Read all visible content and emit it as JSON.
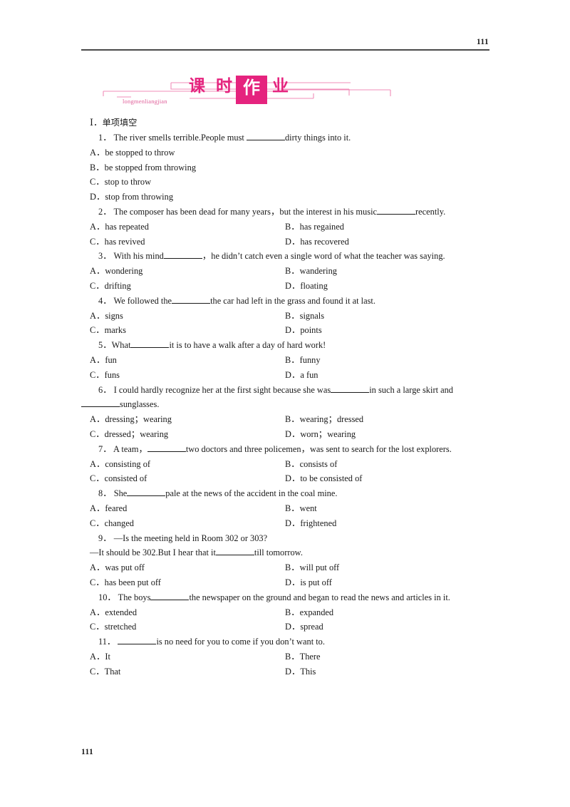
{
  "header": {
    "folio": "111"
  },
  "banner": {
    "pinyin": "longmenliangjian",
    "char1": "课",
    "char2": "时",
    "char3_boxed": "作",
    "char4": "业",
    "accent_color": "#e5237e",
    "accent_light": "#f2a0c4"
  },
  "section": {
    "label": "Ⅰ",
    "separator": "．",
    "title_cn": "单项填空"
  },
  "questions": [
    {
      "number": "1．",
      "stem_pre": "The river smells terrible.People must ",
      "stem_post": "dirty things into it.",
      "layout": "stacked",
      "options": [
        {
          "mark": "A．",
          "text": "be stopped to throw"
        },
        {
          "mark": "B．",
          "text": "be stopped from throwing"
        },
        {
          "mark": "C．",
          "text": "stop to throw"
        },
        {
          "mark": "D．",
          "text": "stop from throwing"
        }
      ]
    },
    {
      "number": "2．",
      "stem_pre": "The composer has been dead for many years，but the interest in his music",
      "stem_post": "recently.",
      "justify": true,
      "layout": "two-column",
      "options": [
        {
          "mark": "A．",
          "text": "has repeated"
        },
        {
          "mark": "B．",
          "text": "has regained"
        },
        {
          "mark": "C．",
          "text": "has revived"
        },
        {
          "mark": "D．",
          "text": "has recovered"
        }
      ]
    },
    {
      "number": "3．",
      "stem_pre": "With his mind",
      "stem_post": "，he didn’t catch even a single word of what the teacher was saying.",
      "layout": "two-column",
      "options": [
        {
          "mark": "A．",
          "text": "wondering"
        },
        {
          "mark": "B．",
          "text": "wandering"
        },
        {
          "mark": "C．",
          "text": "drifting"
        },
        {
          "mark": "D．",
          "text": "floating"
        }
      ]
    },
    {
      "number": "4．",
      "stem_pre": "We followed the",
      "stem_post": "the car had left in the grass and found it at last.",
      "layout": "two-column",
      "options": [
        {
          "mark": "A．",
          "text": "signs"
        },
        {
          "mark": "B．",
          "text": "signals"
        },
        {
          "mark": "C．",
          "text": "marks"
        },
        {
          "mark": "D．",
          "text": "points"
        }
      ]
    },
    {
      "number": "5．",
      "stem_pre": "What",
      "stem_post": "it is to have a walk after a day of hard work!",
      "layout": "two-column",
      "options": [
        {
          "mark": "A．",
          "text": "fun"
        },
        {
          "mark": "B．",
          "text": "funny"
        },
        {
          "mark": "C．",
          "text": "funs"
        },
        {
          "mark": "D．",
          "text": "a fun"
        }
      ]
    },
    {
      "number": "6．",
      "stem_pre": "I could hardly recognize her at the first sight because she was",
      "stem_mid": "in such a large skirt and",
      "stem_post": "sunglasses.",
      "layout": "two-column",
      "options": [
        {
          "mark": "A．",
          "text": "dressing；wearing"
        },
        {
          "mark": "B．",
          "text": "wearing；dressed"
        },
        {
          "mark": "C．",
          "text": "dressed；wearing"
        },
        {
          "mark": "D．",
          "text": "worn；wearing"
        }
      ]
    },
    {
      "number": "7．",
      "stem_pre": "A team，",
      "stem_post": "two doctors and three policemen，was sent to search for the lost explorers.",
      "justify": true,
      "layout": "two-column",
      "options": [
        {
          "mark": "A．",
          "text": "consisting of"
        },
        {
          "mark": "B．",
          "text": "consists of"
        },
        {
          "mark": "C．",
          "text": "consisted of"
        },
        {
          "mark": "D．",
          "text": "to be consisted of"
        }
      ]
    },
    {
      "number": "8．",
      "stem_pre": "She",
      "stem_post": "pale at the news of the accident in the coal mine.",
      "layout": "two-column",
      "options": [
        {
          "mark": "A．",
          "text": "feared"
        },
        {
          "mark": "B．",
          "text": "went"
        },
        {
          "mark": "C．",
          "text": "changed"
        },
        {
          "mark": "D．",
          "text": "frightened"
        }
      ]
    },
    {
      "number": "9．",
      "dialogue_line1": "—Is the meeting held in Room 302 or 303?",
      "stem_pre": "—It should be 302.But I hear that it",
      "stem_post": "till tomorrow.",
      "layout": "two-column",
      "options": [
        {
          "mark": "A．",
          "text": "was put off"
        },
        {
          "mark": "B．",
          "text": "will put off"
        },
        {
          "mark": "C．",
          "text": "has been put off"
        },
        {
          "mark": "D．",
          "text": "is put off"
        }
      ]
    },
    {
      "number": "10．",
      "stem_pre": "The boys",
      "stem_post": "the newspaper on the ground and began to read the news and articles in it.",
      "layout": "two-column",
      "options": [
        {
          "mark": "A．",
          "text": "extended"
        },
        {
          "mark": "B．",
          "text": "expanded"
        },
        {
          "mark": "C．",
          "text": "stretched"
        },
        {
          "mark": "D．",
          "text": "spread"
        }
      ]
    },
    {
      "number": "11．",
      "stem_pre": "",
      "stem_post": "is no need for you to come if you don’t want to.",
      "layout": "two-column",
      "options": [
        {
          "mark": "A．",
          "text": "It"
        },
        {
          "mark": "B．",
          "text": "There"
        },
        {
          "mark": "C．",
          "text": "That"
        },
        {
          "mark": "D．",
          "text": "This"
        }
      ]
    }
  ],
  "footer": {
    "folio": "111"
  }
}
